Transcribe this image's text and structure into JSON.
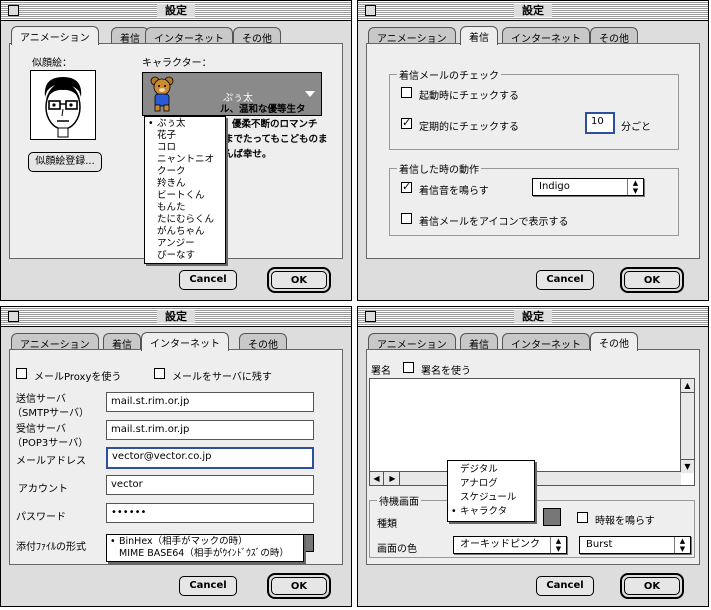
{
  "window_title": "設定",
  "tabs": [
    "アニメーション",
    "着信",
    "インターネット",
    "その他"
  ],
  "buttons": {
    "cancel": "Cancel",
    "ok": "OK"
  },
  "anim": {
    "portrait_label": "似顔絵：",
    "register_button": "似顔絵登録...",
    "character_label": "キャラクター：",
    "selected_character": "ぷぅ太",
    "character_options": [
      "ぷぅ太",
      "花子",
      "コロ",
      "ニャントニオ",
      "クーク",
      "羚きん",
      "ビートくん",
      "もんた",
      "たにむらくん",
      "がんちゃん",
      "アンジー",
      "ぴーなす"
    ],
    "description_lines": [
      "ル、温和な優等生タ",
      "優柔不断のロマンチ",
      "までたってもこどものま",
      "んば幸せ。"
    ]
  },
  "arrive": {
    "check_group": "着信メールのチェック",
    "check_on_startup": "起動時にチェックする",
    "check_periodic": "定期的にチェックする",
    "interval_value": "10",
    "interval_unit": "分ごと",
    "action_group": "着信した時の動作",
    "play_sound": "着信音を鳴らす",
    "sound_name": "Indigo",
    "show_icon": "着信メールをアイコンで表示する",
    "states": {
      "startup": false,
      "periodic": true,
      "sound": true,
      "icon": false
    }
  },
  "internet": {
    "use_proxy": "メールProxyを使う",
    "leave_on_server": "メールをサーバに残す",
    "smtp_label_1": "送信サーバ",
    "smtp_label_2": "（SMTPサーバ）",
    "smtp_value": "mail.st.rim.or.jp",
    "pop_label_1": "受信サーバ",
    "pop_label_2": "（POP3サーバ）",
    "pop_value": "mail.st.rim.or.jp",
    "address_label": "メールアドレス",
    "address_value": "vector@vector.co.jp",
    "account_label": "アカウント",
    "account_value": "vector",
    "password_label": "パスワード",
    "password_value": "••••••",
    "attach_label": "添付ﾌｧｲﾙの形式",
    "attach_options": [
      "BinHex（相手がマックの時）",
      "MIME BASE64（相手がｳｲﾝﾄﾞｳｽﾞの時）"
    ]
  },
  "other": {
    "signature_label": "署名",
    "use_signature": "署名を使う",
    "screensaver_group": "待機画面",
    "kind_label": "種類",
    "kind_options": [
      "デジタル",
      "アナログ",
      "スケジュール",
      "キャラクタ"
    ],
    "chime_label": "時報を鳴らす",
    "color_label": "画面の色",
    "color_value": "オーキッドピンク",
    "effect_value": "Burst"
  },
  "colors": {
    "window_bg": "#dddddd",
    "panel_bg": "#eeeeee",
    "focus_ring": "#2c4f9e",
    "face_highlight": "#7a7a7a"
  }
}
